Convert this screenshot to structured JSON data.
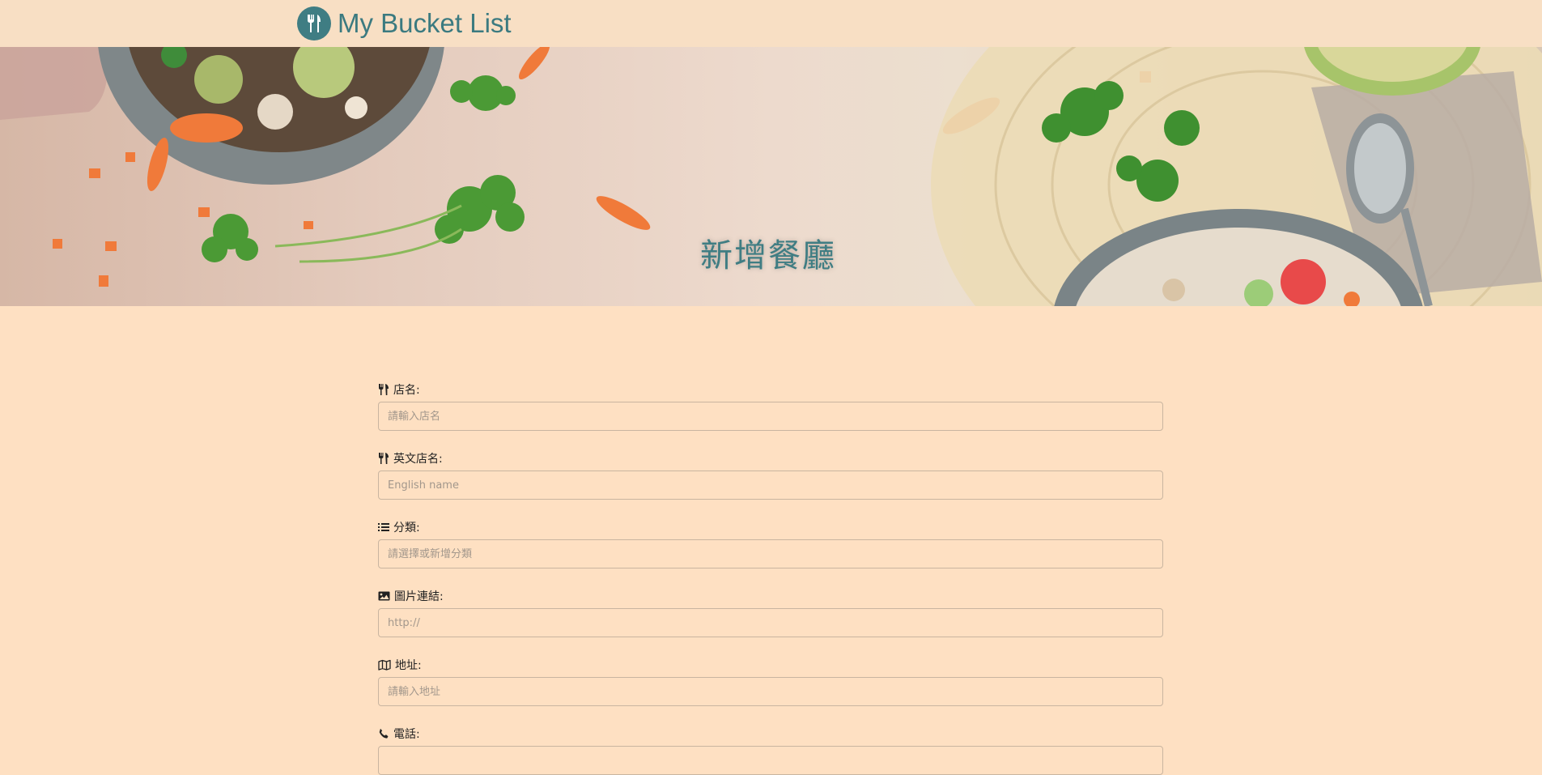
{
  "navbar": {
    "brand_title": "My Bucket List",
    "brand_icon": "utensils-icon"
  },
  "banner": {
    "title": "新增餐廳"
  },
  "form": {
    "fields": [
      {
        "label": "店名:",
        "icon": "utensils-icon",
        "placeholder": "請輸入店名",
        "value": ""
      },
      {
        "label": "英文店名:",
        "icon": "utensils-icon",
        "placeholder": "English name",
        "value": ""
      },
      {
        "label": "分類:",
        "icon": "list-icon",
        "placeholder": "請選擇或新增分類",
        "value": ""
      },
      {
        "label": "圖片連結:",
        "icon": "image-icon",
        "placeholder": "http://",
        "value": ""
      },
      {
        "label": "地址:",
        "icon": "map-icon",
        "placeholder": "請輸入地址",
        "value": ""
      },
      {
        "label": "電話:",
        "icon": "phone-icon",
        "placeholder": "",
        "value": ""
      }
    ]
  },
  "colors": {
    "background": "#fee0c2",
    "navbar": "#f8dfc4",
    "accent": "#3f7d83",
    "input_border": "#c9b5a0"
  }
}
